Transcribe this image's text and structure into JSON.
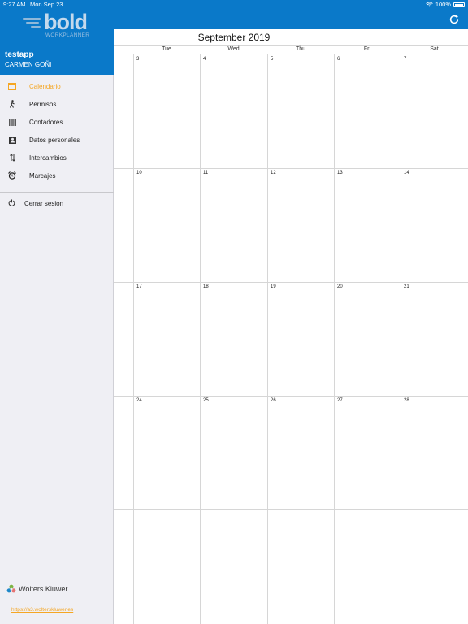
{
  "status_bar": {
    "time": "9:27 AM",
    "date": "Mon Sep 23",
    "battery": "100%"
  },
  "sidebar": {
    "logo": {
      "word": "bold",
      "subtitle": "WORKPLANNER"
    },
    "user": {
      "username": "testapp",
      "full_name": "CARMEN GOÑI"
    },
    "items": [
      {
        "label": "Calendario",
        "icon": "calendar-icon",
        "active": true
      },
      {
        "label": "Permisos",
        "icon": "walking-icon",
        "active": false
      },
      {
        "label": "Contadores",
        "icon": "barcode-icon",
        "active": false
      },
      {
        "label": "Datos personales",
        "icon": "id-card-icon",
        "active": false
      },
      {
        "label": "Intercambios",
        "icon": "swap-icon",
        "active": false
      },
      {
        "label": "Marcajes",
        "icon": "alarm-clock-icon",
        "active": false
      }
    ],
    "logout_label": "Cerrar sesion",
    "footer": {
      "brand": "Wolters Kluwer",
      "link": "https://a3.wolterskluwer.es"
    }
  },
  "calendar": {
    "month_title": "September 2019",
    "weekdays": [
      "Tue",
      "Wed",
      "Thu",
      "Fri",
      "Sat"
    ],
    "weeks": [
      [
        "3",
        "4",
        "5",
        "6",
        "7"
      ],
      [
        "10",
        "11",
        "12",
        "13",
        "14"
      ],
      [
        "17",
        "18",
        "19",
        "20",
        "21"
      ],
      [
        "24",
        "25",
        "26",
        "27",
        "28"
      ],
      [
        "",
        "",
        "",
        "",
        ""
      ]
    ]
  },
  "colors": {
    "brand_blue": "#0a79c9",
    "accent_orange": "#f5a623",
    "sidebar_bg": "#efeff4"
  }
}
